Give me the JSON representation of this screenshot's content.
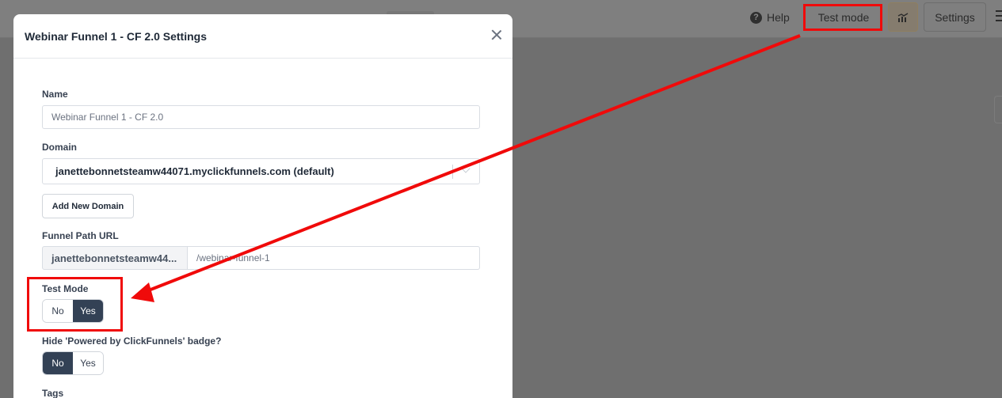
{
  "topbar": {
    "help_label": "Help",
    "test_mode_label": "Test mode",
    "settings_label": "Settings"
  },
  "modal": {
    "title": "Webinar Funnel 1 - CF 2.0 Settings",
    "name": {
      "label": "Name",
      "value": "Webinar Funnel 1 - CF 2.0"
    },
    "domain": {
      "label": "Domain",
      "selected": "janettebonnetsteamw44071.myclickfunnels.com (default)",
      "add_button": "Add New Domain"
    },
    "funnel_path": {
      "label": "Funnel Path URL",
      "prefix": "janettebonnetsteamw44...",
      "value": "/webinar-funnel-1"
    },
    "test_mode": {
      "label": "Test Mode",
      "options": [
        "No",
        "Yes"
      ],
      "selected": "Yes"
    },
    "hide_badge": {
      "label": "Hide 'Powered by ClickFunnels' badge?",
      "options": [
        "No",
        "Yes"
      ],
      "selected": "No"
    },
    "tags": {
      "label": "Tags"
    }
  },
  "colors": {
    "annotation": "#f00a0a",
    "toggle_active": "#334155",
    "overlay": "#6f6f6f"
  }
}
